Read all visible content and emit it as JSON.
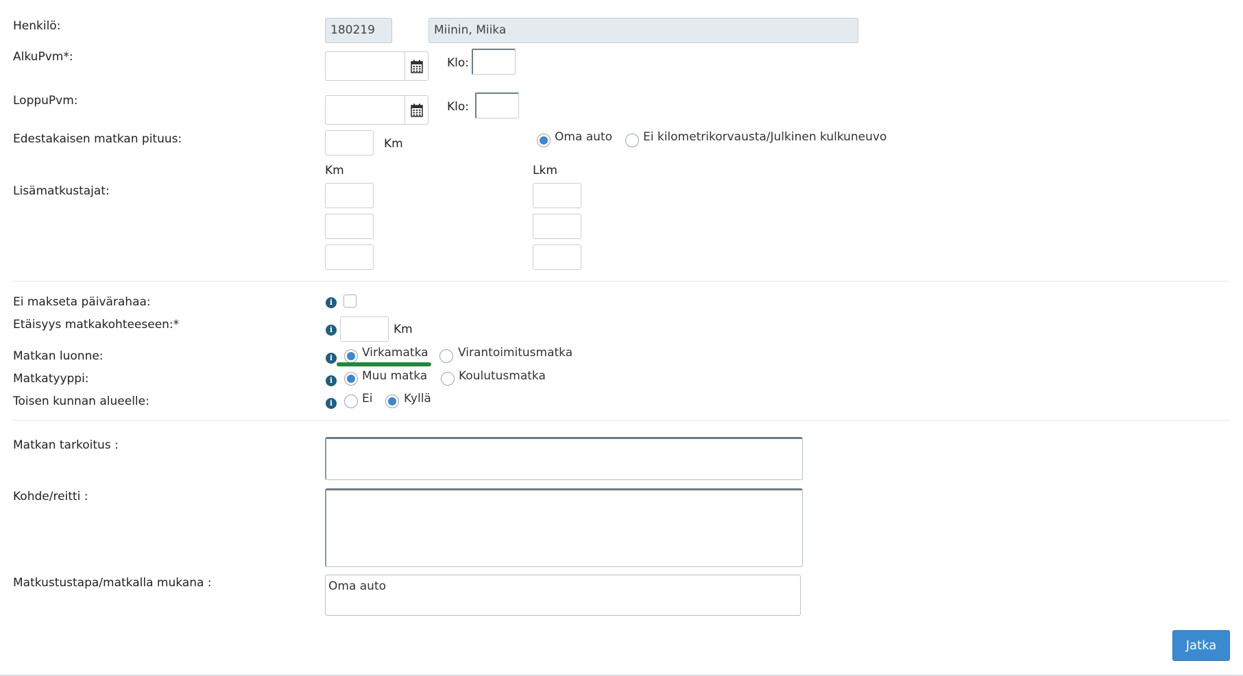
{
  "form": {
    "person": {
      "label": "Henkilö:",
      "id": "180219",
      "name": "Miinin, Miika"
    },
    "start": {
      "label": "AlkuPvm*:",
      "time_label": "Klo:"
    },
    "end": {
      "label": "LoppuPvm:",
      "time_label": "Klo:"
    },
    "round_trip": {
      "label": "Edestakaisen matkan pituus:",
      "unit": "Km",
      "options": [
        "Oma auto",
        "Ei kilometrikorvausta/Julkinen kulkuneuvo"
      ],
      "selected": "Oma auto"
    },
    "extra": {
      "label": "Lisämatkustajat:",
      "col_km": "Km",
      "col_count": "Lkm"
    },
    "no_allowance": {
      "label": "Ei makseta päivärahaa:",
      "checked": false
    },
    "distance": {
      "label": "Etäisyys matkakohteeseen:*",
      "unit": "Km"
    },
    "trip_nature": {
      "label": "Matkan luonne:",
      "options": [
        "Virkamatka",
        "Virantoimitusmatka"
      ],
      "selected": "Virkamatka"
    },
    "trip_type": {
      "label": "Matkatyyppi:",
      "options": [
        "Muu matka",
        "Koulutusmatka"
      ],
      "selected": "Muu matka"
    },
    "other_municipality": {
      "label": "Toisen kunnan alueelle:",
      "options": [
        "Ei",
        "Kyllä"
      ],
      "selected": "Kyllä"
    },
    "purpose": {
      "label": "Matkan tarkoitus :",
      "value": ""
    },
    "route": {
      "label": "Kohde/reitti :",
      "value": ""
    },
    "travel_mode": {
      "label": "Matkustustapa/matkalla mukana :",
      "value": "Oma auto"
    },
    "submit_label": "Jatka",
    "colors": {
      "accent": "#3b8ad0",
      "info": "#1e5e82",
      "highlight": "#1f8a3a"
    }
  }
}
